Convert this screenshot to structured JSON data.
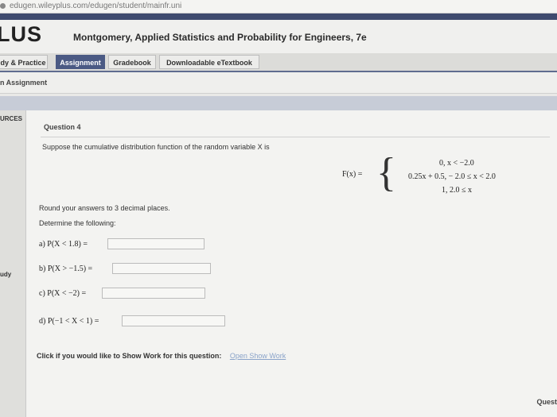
{
  "browser": {
    "url": "edugen.wileyplus.com/edugen/student/mainfr.uni"
  },
  "header": {
    "logo": "LUS",
    "book_title": "Montgomery, Applied Statistics and Probability for Engineers, 7e"
  },
  "tabs": [
    {
      "label": "dy & Practice",
      "active": false
    },
    {
      "label": "Assignment",
      "active": true
    },
    {
      "label": "Gradebook",
      "active": false
    },
    {
      "label": "Downloadable eTextbook",
      "active": false
    }
  ],
  "subheader": {
    "title": "n Assignment"
  },
  "sidebar": {
    "top_label": "URCES",
    "mid_label": "udy"
  },
  "question": {
    "title": "Question 4",
    "prompt": "Suppose the cumulative distribution function of the random variable X is",
    "formula": {
      "lhs": "F(x) =",
      "cases": [
        "0, x < −2.0",
        "0.25x + 0.5,  − 2.0 ≤ x < 2.0",
        "1, 2.0 ≤ x"
      ]
    },
    "instruction": "Round your answers to 3 decimal places.",
    "determine": "Determine the following:",
    "parts": [
      {
        "label": "a) P(X < 1.8) =",
        "value": ""
      },
      {
        "label": "b) P(X > −1.5) =",
        "value": ""
      },
      {
        "label": "c) P(X < −2) =",
        "value": ""
      },
      {
        "label": "d) P(−1 < X < 1) =",
        "value": ""
      }
    ],
    "show_work_prompt": "Click if you would like to Show Work for this question:",
    "show_work_link": "Open Show Work"
  },
  "footer": {
    "label": "Quest"
  },
  "colors": {
    "accent": "#4b5a84",
    "topbar": "#3e4a6e",
    "link": "#8aa3c9"
  }
}
